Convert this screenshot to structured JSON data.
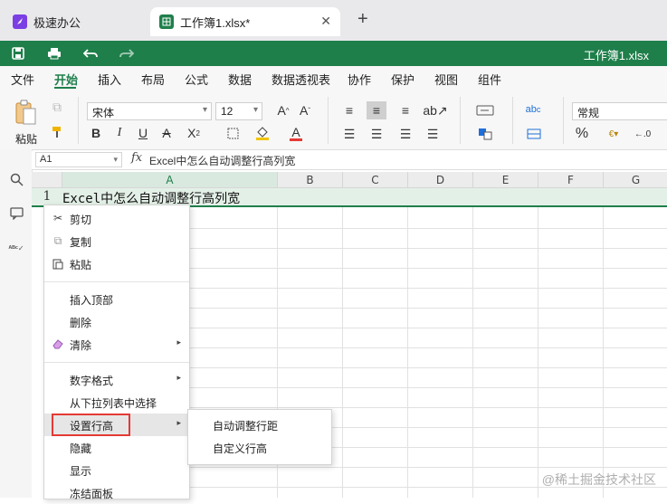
{
  "tabs": [
    {
      "label": "极速办公",
      "icon": "rocket-icon"
    },
    {
      "label": "工作簿1.xlsx*",
      "icon": "spreadsheet-icon"
    }
  ],
  "titlebar": {
    "doc_title": "工作簿1.xlsx"
  },
  "menu": [
    "文件",
    "开始",
    "插入",
    "布局",
    "公式",
    "数据",
    "数据透视表",
    "协作",
    "保护",
    "视图",
    "组件"
  ],
  "ribbon": {
    "paste_label": "粘贴",
    "font_name": "宋体",
    "font_size": "12",
    "number_format": "常规",
    "percent": "%"
  },
  "formula_bar": {
    "cell_ref": "A1",
    "fx": "fx",
    "content": "Excel中怎么自动调整行高列宽"
  },
  "grid": {
    "columns": [
      "A",
      "B",
      "C",
      "D",
      "E",
      "F",
      "G"
    ],
    "row1_number": "1",
    "a1_value": "Excel中怎么自动调整行高列宽"
  },
  "context_menu": {
    "items": [
      {
        "label": "剪切",
        "icon": "scissors-icon"
      },
      {
        "label": "复制",
        "icon": "copy-icon"
      },
      {
        "label": "粘贴",
        "icon": "paste-icon"
      },
      {
        "label": "插入顶部"
      },
      {
        "label": "删除"
      },
      {
        "label": "清除",
        "icon": "eraser-icon",
        "submenu": true
      },
      {
        "label": "数字格式",
        "submenu": true
      },
      {
        "label": "从下拉列表中选择"
      },
      {
        "label": "设置行高",
        "submenu": true,
        "highlighted": true
      },
      {
        "label": "隐藏"
      },
      {
        "label": "显示"
      },
      {
        "label": "冻结面板"
      }
    ]
  },
  "submenu": {
    "items": [
      "自动调整行距",
      "自定义行高"
    ]
  },
  "watermark": "@稀土掘金技术社区",
  "colors": {
    "accent": "#1f7f4b",
    "highlight_border": "#e53935"
  }
}
